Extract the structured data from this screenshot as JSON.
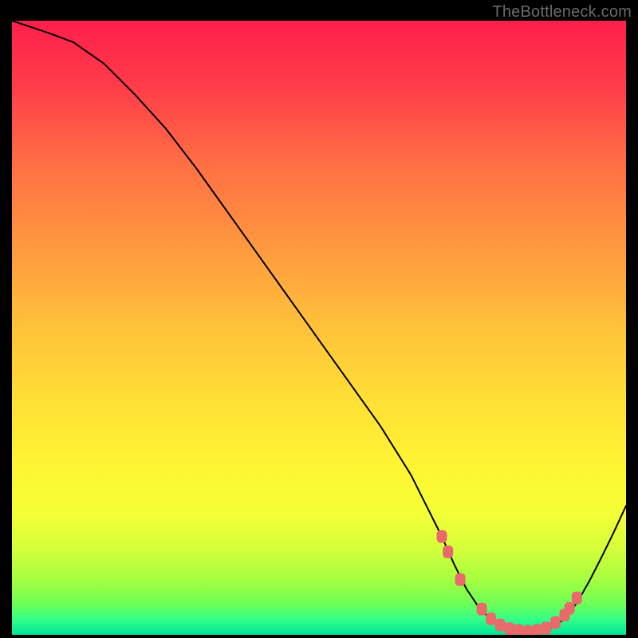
{
  "watermark": "TheBottleneck.com",
  "chart_data": {
    "type": "line",
    "title": "",
    "xlabel": "",
    "ylabel": "",
    "xlim": [
      0,
      100
    ],
    "ylim": [
      0,
      100
    ],
    "grid": false,
    "legend": false,
    "background_gradient": {
      "stops": [
        {
          "offset": 0.0,
          "color": "#ff1f4b"
        },
        {
          "offset": 0.1,
          "color": "#ff3a4a"
        },
        {
          "offset": 0.22,
          "color": "#ff6a44"
        },
        {
          "offset": 0.36,
          "color": "#ff9640"
        },
        {
          "offset": 0.5,
          "color": "#ffc23a"
        },
        {
          "offset": 0.62,
          "color": "#ffe035"
        },
        {
          "offset": 0.72,
          "color": "#fff433"
        },
        {
          "offset": 0.8,
          "color": "#f6ff36"
        },
        {
          "offset": 0.86,
          "color": "#d4ff3a"
        },
        {
          "offset": 0.91,
          "color": "#a6ff40"
        },
        {
          "offset": 0.95,
          "color": "#6dff57"
        },
        {
          "offset": 0.975,
          "color": "#33ff88"
        },
        {
          "offset": 1.0,
          "color": "#00e59a"
        }
      ]
    },
    "series": [
      {
        "name": "bottleneck-curve",
        "color": "#000000",
        "stroke_width": 2,
        "x": [
          0,
          3,
          6,
          10,
          15,
          20,
          25,
          30,
          35,
          40,
          45,
          50,
          55,
          60,
          65,
          68,
          70,
          72,
          74,
          76,
          78,
          80,
          82,
          84,
          86,
          88,
          90,
          92,
          94,
          96,
          98,
          100
        ],
        "y": [
          100,
          99,
          98,
          96.5,
          93,
          88,
          82.5,
          76,
          69,
          62,
          55,
          48,
          41,
          34,
          26,
          20,
          16,
          11.5,
          7.5,
          4.5,
          2.5,
          1.3,
          0.7,
          0.5,
          0.6,
          1.2,
          2.6,
          5.2,
          8.7,
          12.6,
          16.7,
          21
        ]
      }
    ],
    "markers": {
      "name": "sweet-spot-markers",
      "color": "#e86a6a",
      "shape": "rounded-rect",
      "points": [
        {
          "x": 70.0,
          "y": 16.0
        },
        {
          "x": 71.0,
          "y": 13.5
        },
        {
          "x": 73.0,
          "y": 9.0
        },
        {
          "x": 76.5,
          "y": 4.2
        },
        {
          "x": 78.0,
          "y": 2.6
        },
        {
          "x": 79.5,
          "y": 1.6
        },
        {
          "x": 81.0,
          "y": 1.0
        },
        {
          "x": 82.5,
          "y": 0.7
        },
        {
          "x": 84.0,
          "y": 0.55
        },
        {
          "x": 85.5,
          "y": 0.7
        },
        {
          "x": 87.0,
          "y": 1.1
        },
        {
          "x": 88.5,
          "y": 2.0
        },
        {
          "x": 90.0,
          "y": 3.2
        },
        {
          "x": 90.8,
          "y": 4.3
        },
        {
          "x": 92.0,
          "y": 6.0
        }
      ]
    }
  }
}
